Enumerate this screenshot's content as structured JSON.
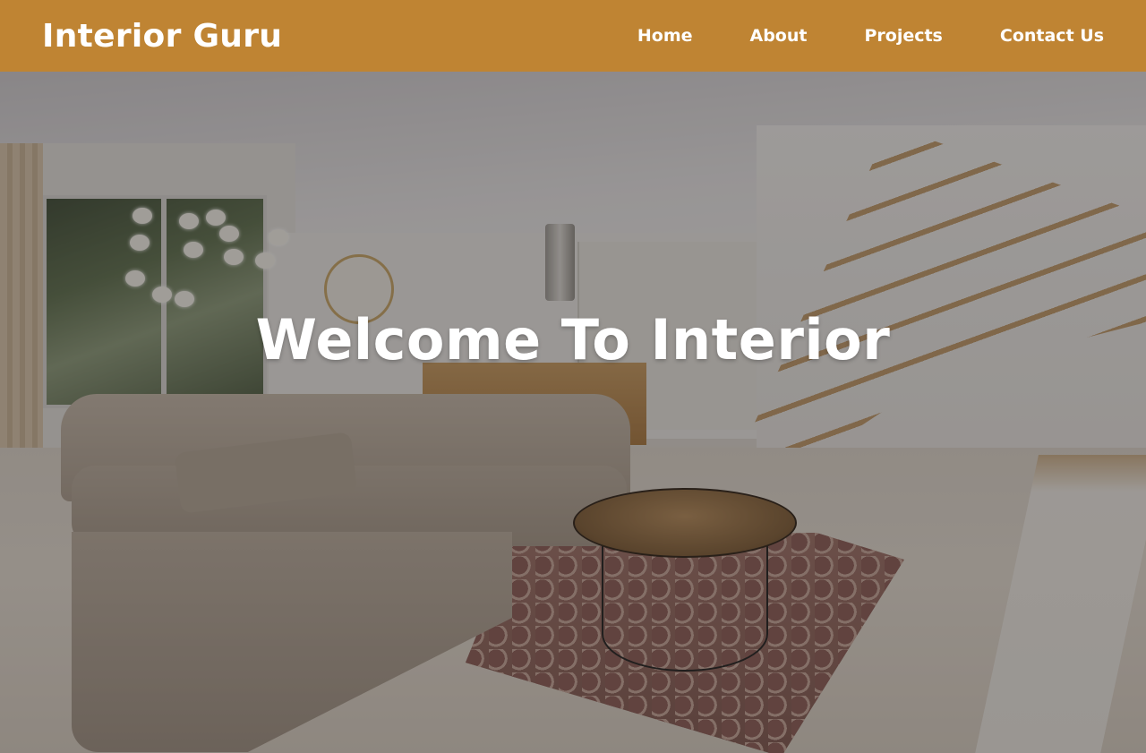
{
  "navbar": {
    "brand": "Interior Guru",
    "links": [
      {
        "label": "Home"
      },
      {
        "label": "About"
      },
      {
        "label": "Projects"
      },
      {
        "label": "Contact Us"
      }
    ],
    "background_color": "#bf8433"
  },
  "hero": {
    "headline": "Welcome To Interior",
    "background_image": "living-room-with-sofa-staircase-and-coffee-table",
    "text_color": "#ffffff"
  }
}
